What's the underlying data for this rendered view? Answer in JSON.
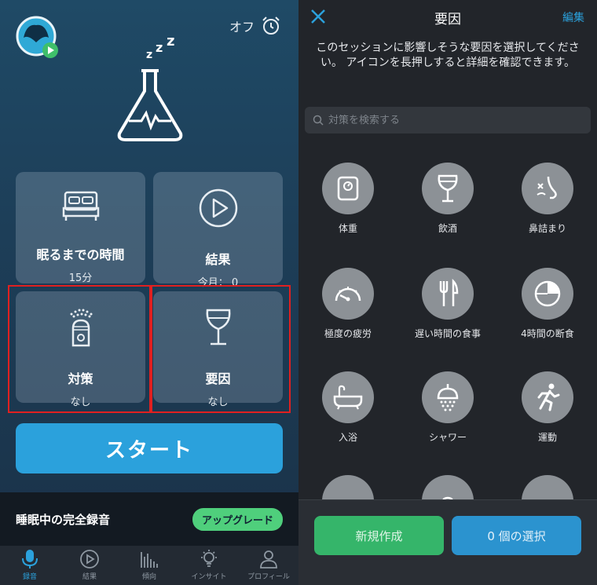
{
  "left": {
    "alarm_label": "オフ",
    "tiles": {
      "sleep": {
        "title": "眠るまでの時間",
        "sub": "15分"
      },
      "result": {
        "title": "結果",
        "sub": "今月： 0"
      },
      "remedy": {
        "title": "対策",
        "sub": "なし"
      },
      "factor": {
        "title": "要因",
        "sub": "なし"
      }
    },
    "start_label": "スタート",
    "record_label": "睡眠中の完全録音",
    "upgrade_label": "アップグレード",
    "tabs": [
      {
        "label": "録音",
        "icon": "mic-icon",
        "active": true
      },
      {
        "label": "結果",
        "icon": "play-icon"
      },
      {
        "label": "傾向",
        "icon": "bars-icon"
      },
      {
        "label": "インサイト",
        "icon": "lightbulb-icon"
      },
      {
        "label": "プロフィール",
        "icon": "person-icon"
      }
    ]
  },
  "right": {
    "title": "要因",
    "edit_label": "編集",
    "description": "このセッションに影響しそうな要因を選択してください。 アイコンを長押しすると詳細を確認できます。",
    "search_placeholder": "対策を検索する",
    "factors": [
      {
        "label": "体重",
        "icon": "scale-icon"
      },
      {
        "label": "飲酒",
        "icon": "wine-glass-icon"
      },
      {
        "label": "鼻詰まり",
        "icon": "nose-icon"
      },
      {
        "label": "極度の疲労",
        "icon": "gauge-icon"
      },
      {
        "label": "遅い時間の食事",
        "icon": "fork-knife-icon"
      },
      {
        "label": "4時間の断食",
        "icon": "pie-clock-icon"
      },
      {
        "label": "入浴",
        "icon": "bathtub-icon"
      },
      {
        "label": "シャワー",
        "icon": "shower-icon"
      },
      {
        "label": "運動",
        "icon": "running-icon"
      }
    ],
    "new_label": "新規作成",
    "select_label": "0 個の選択"
  },
  "colors": {
    "accent_blue": "#2ba1dc",
    "accent_green": "#35b56a",
    "highlight_red": "#e02020"
  }
}
